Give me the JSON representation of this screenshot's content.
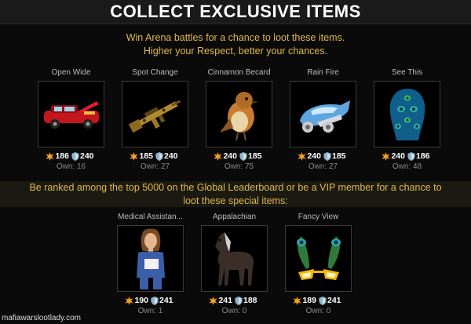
{
  "header": {
    "title": "COLLECT EXCLUSIVE ITEMS"
  },
  "intro": {
    "line1": "Win Arena battles for a chance to loot these items.",
    "line2": "Higher your Respect, better your chances."
  },
  "items": [
    {
      "name": "Open Wide",
      "attack": "186",
      "defense": "240",
      "own": "Own: 16",
      "icon": "red-limousine-icon"
    },
    {
      "name": "Spot Change",
      "attack": "185",
      "defense": "240",
      "own": "Own: 27",
      "icon": "gold-rifle-icon"
    },
    {
      "name": "Cinnamon Becard",
      "attack": "240",
      "defense": "185",
      "own": "Own: 75",
      "icon": "bird-icon"
    },
    {
      "name": "Rain Fire",
      "attack": "240",
      "defense": "185",
      "own": "Own: 27",
      "icon": "jet-car-icon"
    },
    {
      "name": "See This",
      "attack": "240",
      "defense": "186",
      "own": "Own: 48",
      "icon": "peacock-mask-icon"
    }
  ],
  "special": {
    "line1": "Be ranked among the top 5000 on the Global Leaderboard or be a VIP member for a chance to",
    "line2": "loot these special items:"
  },
  "special_items": [
    {
      "name": "Medical Assistan...",
      "attack": "190",
      "defense": "241",
      "own": "Own: 1",
      "icon": "nurse-icon"
    },
    {
      "name": "Appalachian",
      "attack": "241",
      "defense": "188",
      "own": "Own: 0",
      "icon": "horse-icon"
    },
    {
      "name": "Fancy View",
      "attack": "189",
      "defense": "241",
      "own": "Own: 0",
      "icon": "feather-glasses-icon"
    }
  ],
  "watermark": "mafiawarslootlady.com",
  "colors": {
    "gold_text": "#e0b84a",
    "attack_icon": "#f7a21b",
    "defense_icon": "#8fb3c9"
  }
}
